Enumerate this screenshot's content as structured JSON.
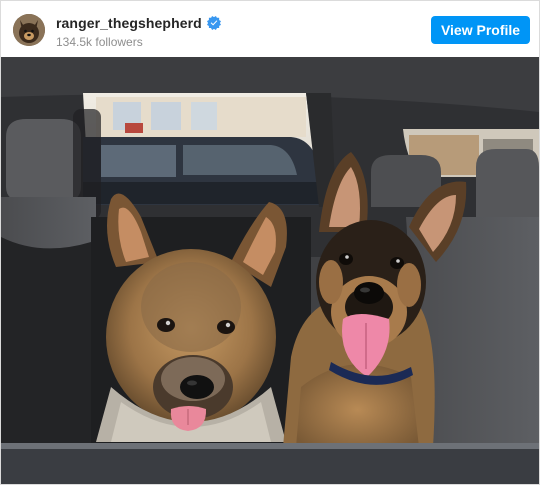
{
  "post": {
    "username": "ranger_thegshepherd",
    "verified": true,
    "followers": "134.5k followers",
    "view_profile_label": "View Profile",
    "accent_color": "#0095f6"
  },
  "icons": {
    "verified": "verified-badge-icon"
  },
  "photo": {
    "subject": "two-german-shepherd-puppies-in-car"
  }
}
